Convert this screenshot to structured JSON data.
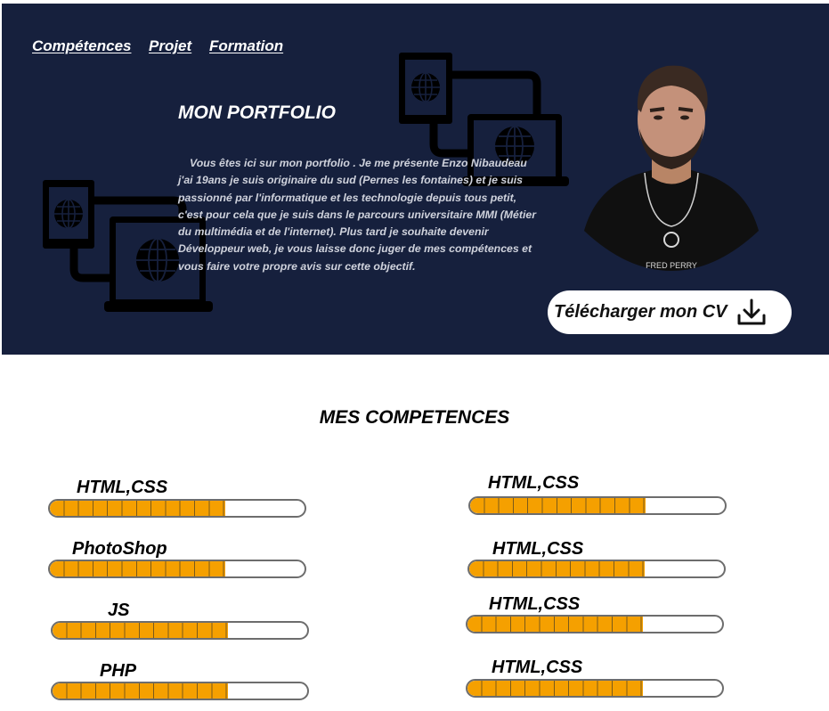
{
  "nav": {
    "items": [
      "Compétences",
      "Projet",
      "Formation"
    ]
  },
  "hero": {
    "title": "MON PORTFOLIO",
    "intro": "Vous êtes ici sur mon portfolio . Je me présente Enzo Nibaudeau j'ai 19ans je suis originaire du sud (Pernes les fontaines) et je suis passionné par l'informatique et les technologie depuis tous petit, c'est pour cela que je suis dans le parcours universitaire MMI (Métier du multimédia et de l'internet). Plus tard je souhaite devenir Développeur web, je vous laisse donc juger de mes compétences et vous faire votre propre avis sur cette objectif.",
    "cv_button": "Télécharger mon CV",
    "shirt_text": "FRED PERRY"
  },
  "skills": {
    "title": "MES COMPETENCES",
    "left": [
      {
        "label": "HTML,CSS",
        "level": 0.69
      },
      {
        "label": "PhotoShop",
        "level": 0.69
      },
      {
        "label": "JS",
        "level": 0.69
      },
      {
        "label": "PHP",
        "level": 0.69
      }
    ],
    "right": [
      {
        "label": "HTML,CSS",
        "level": 0.69
      },
      {
        "label": "HTML,CSS",
        "level": 0.69
      },
      {
        "label": "HTML,CSS",
        "level": 0.69
      },
      {
        "label": "HTML,CSS",
        "level": 0.69
      }
    ]
  },
  "colors": {
    "hero_bg": "#16203d",
    "bar_fill": "#f5a000",
    "bar_border": "#6d6d6d"
  },
  "icons": [
    "devices-network-icon",
    "globe-icon",
    "download-icon"
  ]
}
